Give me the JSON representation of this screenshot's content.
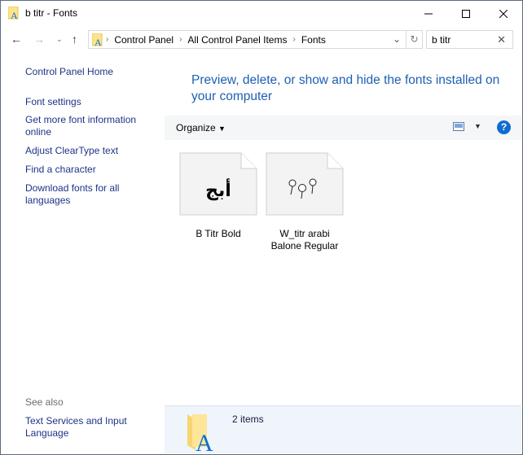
{
  "window": {
    "title": "b titr - Fonts"
  },
  "address": {
    "crumbs": [
      "Control Panel",
      "All Control Panel Items",
      "Fonts"
    ]
  },
  "search": {
    "value": "b titr"
  },
  "sidebar": {
    "home": "Control Panel Home",
    "items": [
      "Font settings",
      "Get more font information online",
      "Adjust ClearType text",
      "Find a character",
      "Download fonts for all languages"
    ],
    "see_also": "See also",
    "see_also_items": [
      "Text Services and Input Language"
    ]
  },
  "main": {
    "heading": "Preview, delete, or show and hide the fonts installed on your computer",
    "organize": "Organize",
    "fonts": [
      {
        "name": "B Titr Bold",
        "preview": "أبج"
      },
      {
        "name": "W_titr arabi Balone Regular",
        "preview": ""
      }
    ],
    "status": "2 items"
  },
  "colors": {
    "link": "#1e3287",
    "heading": "#1e5fb4",
    "accent": "#0078d7"
  }
}
